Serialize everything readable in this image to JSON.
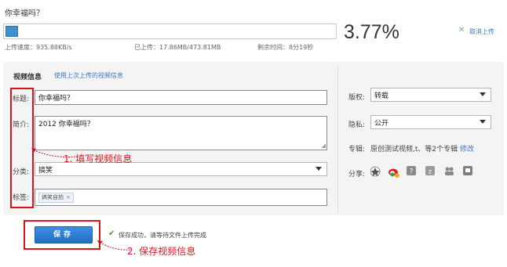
{
  "upload": {
    "file_title": "你幸福吗？",
    "percent_text": "3.77%",
    "progress_fraction": 0.0377,
    "cancel_label": "取消上传",
    "speed_label": "上传速度：",
    "speed_value": "935.88KB/s",
    "uploaded_label": "已上传：",
    "uploaded_value": "17.86MB/473.81MB",
    "remaining_label": "剩余时间：",
    "remaining_value": "8分19秒"
  },
  "video_info": {
    "section_title": "视频信息",
    "use_last_link": "使用上次上传的视频信息",
    "title_label": "标题:",
    "title_value": "你幸福吗？",
    "desc_label": "简介:",
    "desc_value": "2012 你幸福吗？",
    "category_label": "分类:",
    "category_value": "搞笑",
    "tags_label": "标签:",
    "tag_chip": "搞笑自拍",
    "tag_remove": "×"
  },
  "sidebar": {
    "copyright_label": "版权:",
    "copyright_value": "转载",
    "privacy_label": "隐私:",
    "privacy_value": "公开",
    "album_label": "专辑:",
    "album_value": "原创测试视频,t、等2个专辑",
    "album_edit": "修改",
    "share_label": "分享:",
    "share_icons": [
      "qzone-icon",
      "weibo-icon",
      "tencent-weibo-icon",
      "renren-icon",
      "kaixin-icon",
      "douban-icon"
    ]
  },
  "save": {
    "button_label": "保存",
    "status_icon": "check-icon",
    "status_text": "保存成功，请等待文件上传完成"
  },
  "annotations": {
    "step1": "1.  填写视频信息",
    "step2": "2.  保存视频信息"
  },
  "colors": {
    "accent": "#3a79c2",
    "annotation_red": "#d9131b",
    "progress": "#3f8fd1",
    "success": "#46a33c"
  }
}
